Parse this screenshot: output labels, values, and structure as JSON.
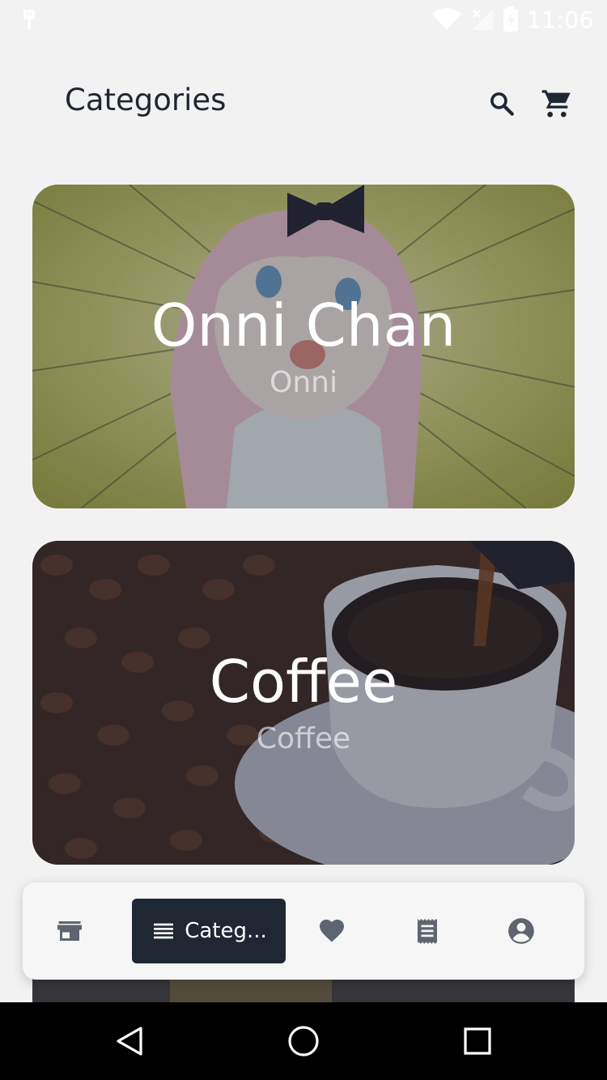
{
  "status": {
    "time": "11:06",
    "icons": [
      "usb-icon",
      "wifi-icon",
      "signal-icon",
      "battery-icon"
    ]
  },
  "header": {
    "title": "Categories",
    "icons": [
      "search-icon",
      "cart-icon"
    ]
  },
  "categories": [
    {
      "title": "Onni Chan",
      "subtitle": "Onni"
    },
    {
      "title": "Coffee",
      "subtitle": "Coffee"
    }
  ],
  "bottom_nav": {
    "items": [
      {
        "icon": "store-icon"
      },
      {
        "icon": "list-icon",
        "label": "Categ..."
      },
      {
        "icon": "heart-icon"
      },
      {
        "icon": "receipt-icon"
      },
      {
        "icon": "account-icon"
      }
    ],
    "active_index": 1
  },
  "system_nav": [
    "back-icon",
    "home-icon",
    "recents-icon"
  ],
  "colors": {
    "background": "#f2f2f2",
    "primary_dark": "#1f2733",
    "card_overlay": "rgba(40,44,60,0.35)"
  }
}
